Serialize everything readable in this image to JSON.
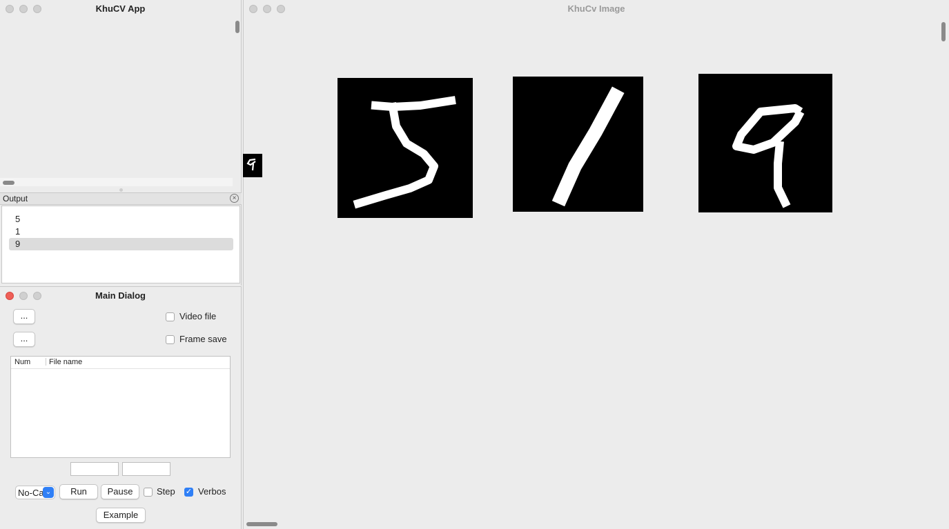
{
  "app_window": {
    "title": "KhuCV App"
  },
  "output": {
    "title": "Output",
    "close_icon": "close-circle-icon",
    "items": [
      "5",
      "1",
      "9"
    ],
    "selected_index": 2
  },
  "dialog": {
    "title": "Main Dialog",
    "browse1_label": "...",
    "browse2_label": "...",
    "video_file_label": "Video file",
    "video_file_checked": false,
    "frame_save_label": "Frame save",
    "frame_save_checked": false,
    "table": {
      "columns": [
        "Num",
        "File name"
      ],
      "rows": []
    },
    "field1_value": "",
    "field2_value": "",
    "mode_select_value": "No-Ca",
    "run_label": "Run",
    "pause_label": "Pause",
    "step_label": "Step",
    "step_checked": false,
    "verbose_label": "Verbos",
    "verbose_checked": true,
    "example_label": "Example"
  },
  "image_window": {
    "title": "KhuCv Image",
    "images": [
      {
        "name": "digit-5-image",
        "depicts": "5"
      },
      {
        "name": "digit-1-image",
        "depicts": "1"
      },
      {
        "name": "digit-9-image",
        "depicts": "9"
      }
    ]
  },
  "colors": {
    "accent": "#2f7ff6",
    "close_red": "#ee5f57",
    "window_bg": "#ececec",
    "selection": "#dcdcdc"
  }
}
